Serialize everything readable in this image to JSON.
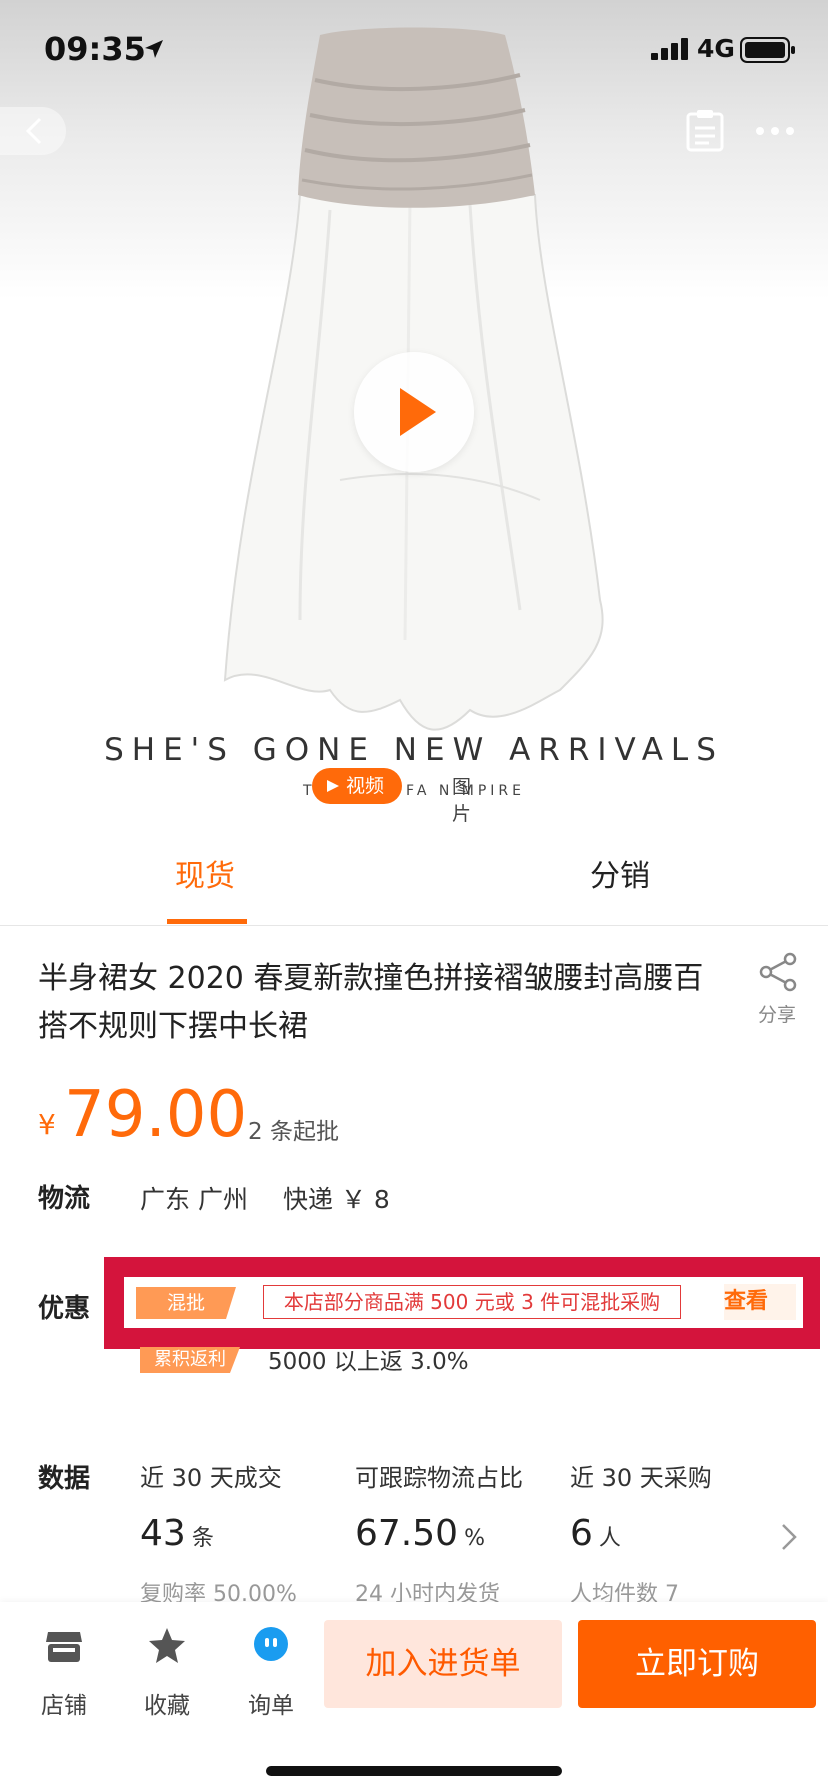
{
  "status_bar": {
    "time": "09:35",
    "network": "4G"
  },
  "hero": {
    "tagline": "SHE'S GONE  NEW ARRIVALS",
    "subline": "THE ES    F FA   N  MPIRE",
    "video_label": "视频",
    "photo_label": "图片"
  },
  "tabs": [
    {
      "label": "现货",
      "active": true
    },
    {
      "label": "分销",
      "active": false
    }
  ],
  "product": {
    "title": "半身裙女 2020 春夏新款撞色拼接褶皱腰封高腰百搭不规则下摆中长裙",
    "share_label": "分享",
    "price_currency": "¥",
    "price": "79.00",
    "min_order": "2 条起批"
  },
  "logistics": {
    "label": "物流",
    "origin": "广东 广州",
    "method": "快递 ￥ 8"
  },
  "promotion": {
    "label": "优惠",
    "mix_badge": "混批",
    "mix_text": "本店部分商品满 500 元或 3 件可混批采购",
    "view_label": "查看",
    "rebate_badge": "累积返利",
    "rebate_text": "5000 以上返 3.0%"
  },
  "stats": {
    "label": "数据",
    "items": [
      {
        "header": "近 30 天成交",
        "value": "43",
        "unit": "条",
        "sub": "复购率 50.00%"
      },
      {
        "header": "可跟踪物流占比",
        "value": "67.50",
        "unit": "%",
        "sub": "24 小时内发货"
      },
      {
        "header": "近 30 天采购",
        "value": "6",
        "unit": "人",
        "sub": "人均件数 7"
      }
    ]
  },
  "bottom_bar": {
    "store": "店铺",
    "favorite": "收藏",
    "inquiry": "询单",
    "add_to_cart": "加入进货单",
    "buy_now": "立即订购"
  },
  "colors": {
    "accent": "#ff6a0a",
    "highlight_box": "#d4143c",
    "buy_button": "#ff6000"
  },
  "icons": [
    "location-arrow-icon",
    "signal-icon",
    "battery-icon",
    "back-chevron-icon",
    "clipboard-icon",
    "more-dots-icon",
    "play-icon",
    "share-icon",
    "chevron-right-icon",
    "store-icon",
    "star-icon",
    "chat-icon"
  ]
}
